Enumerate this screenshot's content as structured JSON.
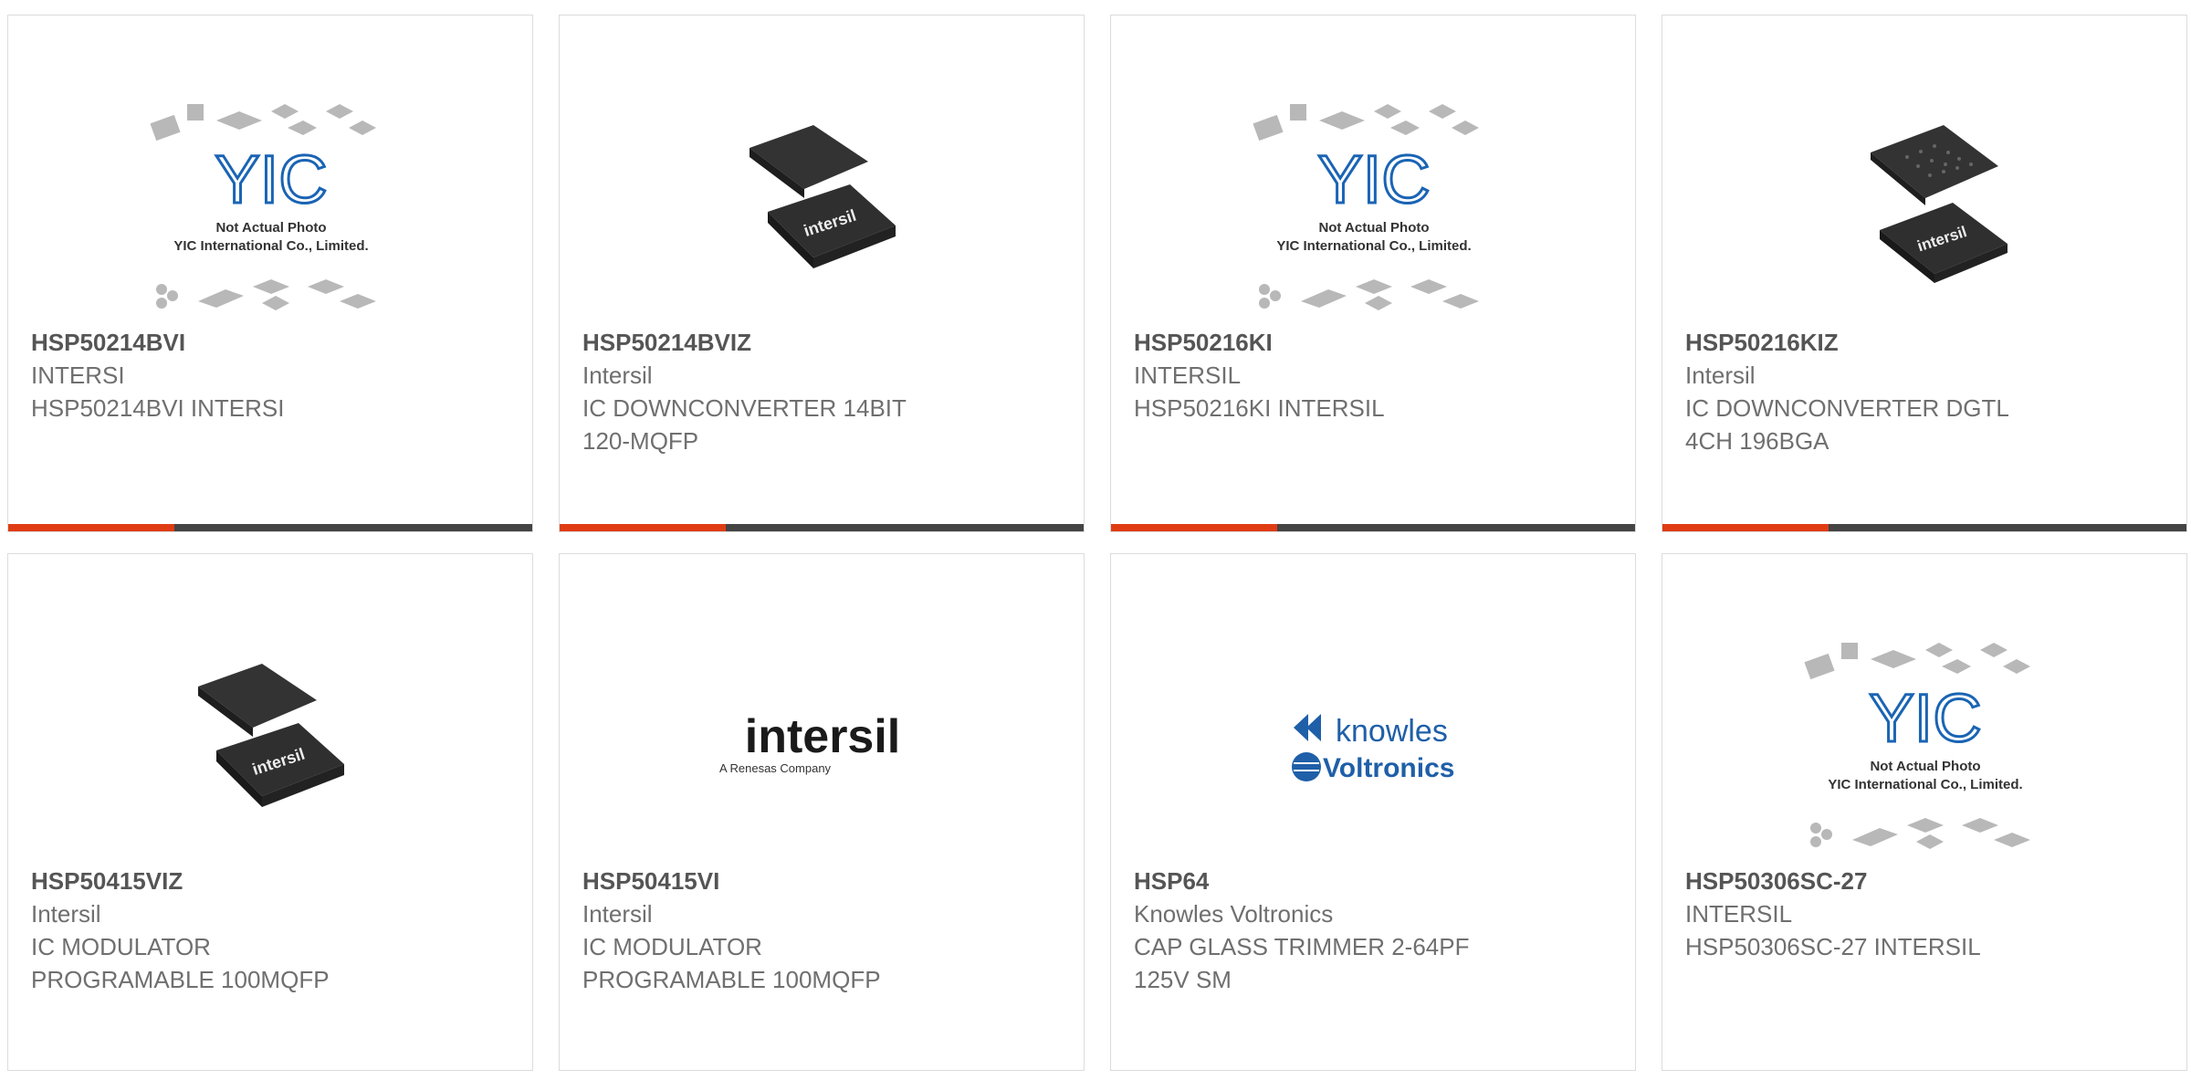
{
  "colors": {
    "accent": "#e03c14",
    "bar": "#444444",
    "border": "#dcdcdc",
    "title": "#555555",
    "text": "#6f6f6f"
  },
  "products": [
    {
      "part": "HSP50214BVI",
      "brand": "INTERSI",
      "desc": [
        "HSP50214BVI INTERSI"
      ],
      "image": "placeholder",
      "placeholder": {
        "logo": "YIC",
        "line1": "Not Actual Photo",
        "line2": "YIC International Co., Limited."
      }
    },
    {
      "part": "HSP50214BVIZ",
      "brand": "Intersil",
      "desc": [
        "IC DOWNCONVERTER 14BIT",
        "120-MQFP"
      ],
      "image": "chip-mqfp",
      "chip_label": "intersil"
    },
    {
      "part": "HSP50216KI",
      "brand": "INTERSIL",
      "desc": [
        "HSP50216KI INTERSIL"
      ],
      "image": "placeholder",
      "placeholder": {
        "logo": "YIC",
        "line1": "Not Actual Photo",
        "line2": "YIC International Co., Limited."
      }
    },
    {
      "part": "HSP50216KIZ",
      "brand": "Intersil",
      "desc": [
        "IC DOWNCONVERTER DGTL",
        "4CH 196BGA"
      ],
      "image": "chip-bga",
      "chip_label": "intersil"
    },
    {
      "part": "HSP50415VIZ",
      "brand": "Intersil",
      "desc": [
        "IC MODULATOR",
        "PROGRAMABLE 100MQFP"
      ],
      "image": "chip-mqfp",
      "chip_label": "intersil"
    },
    {
      "part": "HSP50415VI",
      "brand": "Intersil",
      "desc": [
        "IC MODULATOR",
        "PROGRAMABLE 100MQFP"
      ],
      "image": "logo-intersil",
      "logo": {
        "main": "intersil",
        "sub": "A Renesas Company"
      }
    },
    {
      "part": "HSP64",
      "brand": "Knowles Voltronics",
      "desc": [
        "CAP GLASS TRIMMER 2-64PF",
        "125V SM"
      ],
      "image": "logo-knowles",
      "logo": {
        "line1": "knowles",
        "line2": "Voltronics"
      }
    },
    {
      "part": "HSP50306SC-27",
      "brand": "INTERSIL",
      "desc": [
        "HSP50306SC-27 INTERSIL"
      ],
      "image": "placeholder",
      "placeholder": {
        "logo": "YIC",
        "line1": "Not Actual Photo",
        "line2": "YIC International Co., Limited."
      }
    }
  ]
}
